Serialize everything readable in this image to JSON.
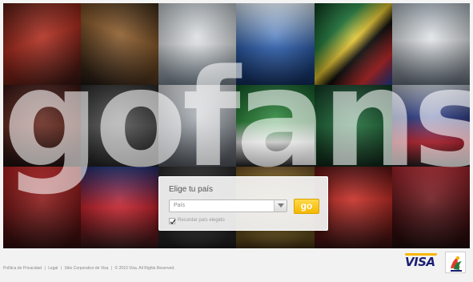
{
  "hero": {
    "wordmark": "gofans"
  },
  "country_panel": {
    "title": "Elige tu país",
    "select": {
      "value": "País",
      "placeholder": "País"
    },
    "go_label": "go",
    "remember_label": "Recordar país elegido",
    "remember_checked": true
  },
  "footer": {
    "links": [
      "Política de Privacidad",
      "Legal",
      "Sitio Corporativo de Visa",
      "© 2010 Visa. All Rights Reserved."
    ],
    "separator": "|"
  },
  "brand": {
    "visa_logo": "VISA",
    "visa_colors": {
      "blue": "#1a1f71",
      "gold": "#f7b600"
    },
    "fifa_icon": "fifa-world-cup-2010-emblem-icon"
  },
  "colors": {
    "accent_go": "#f5b800",
    "panel_bg": "#f0f0f0",
    "footer_bg": "#f2f2f2"
  }
}
